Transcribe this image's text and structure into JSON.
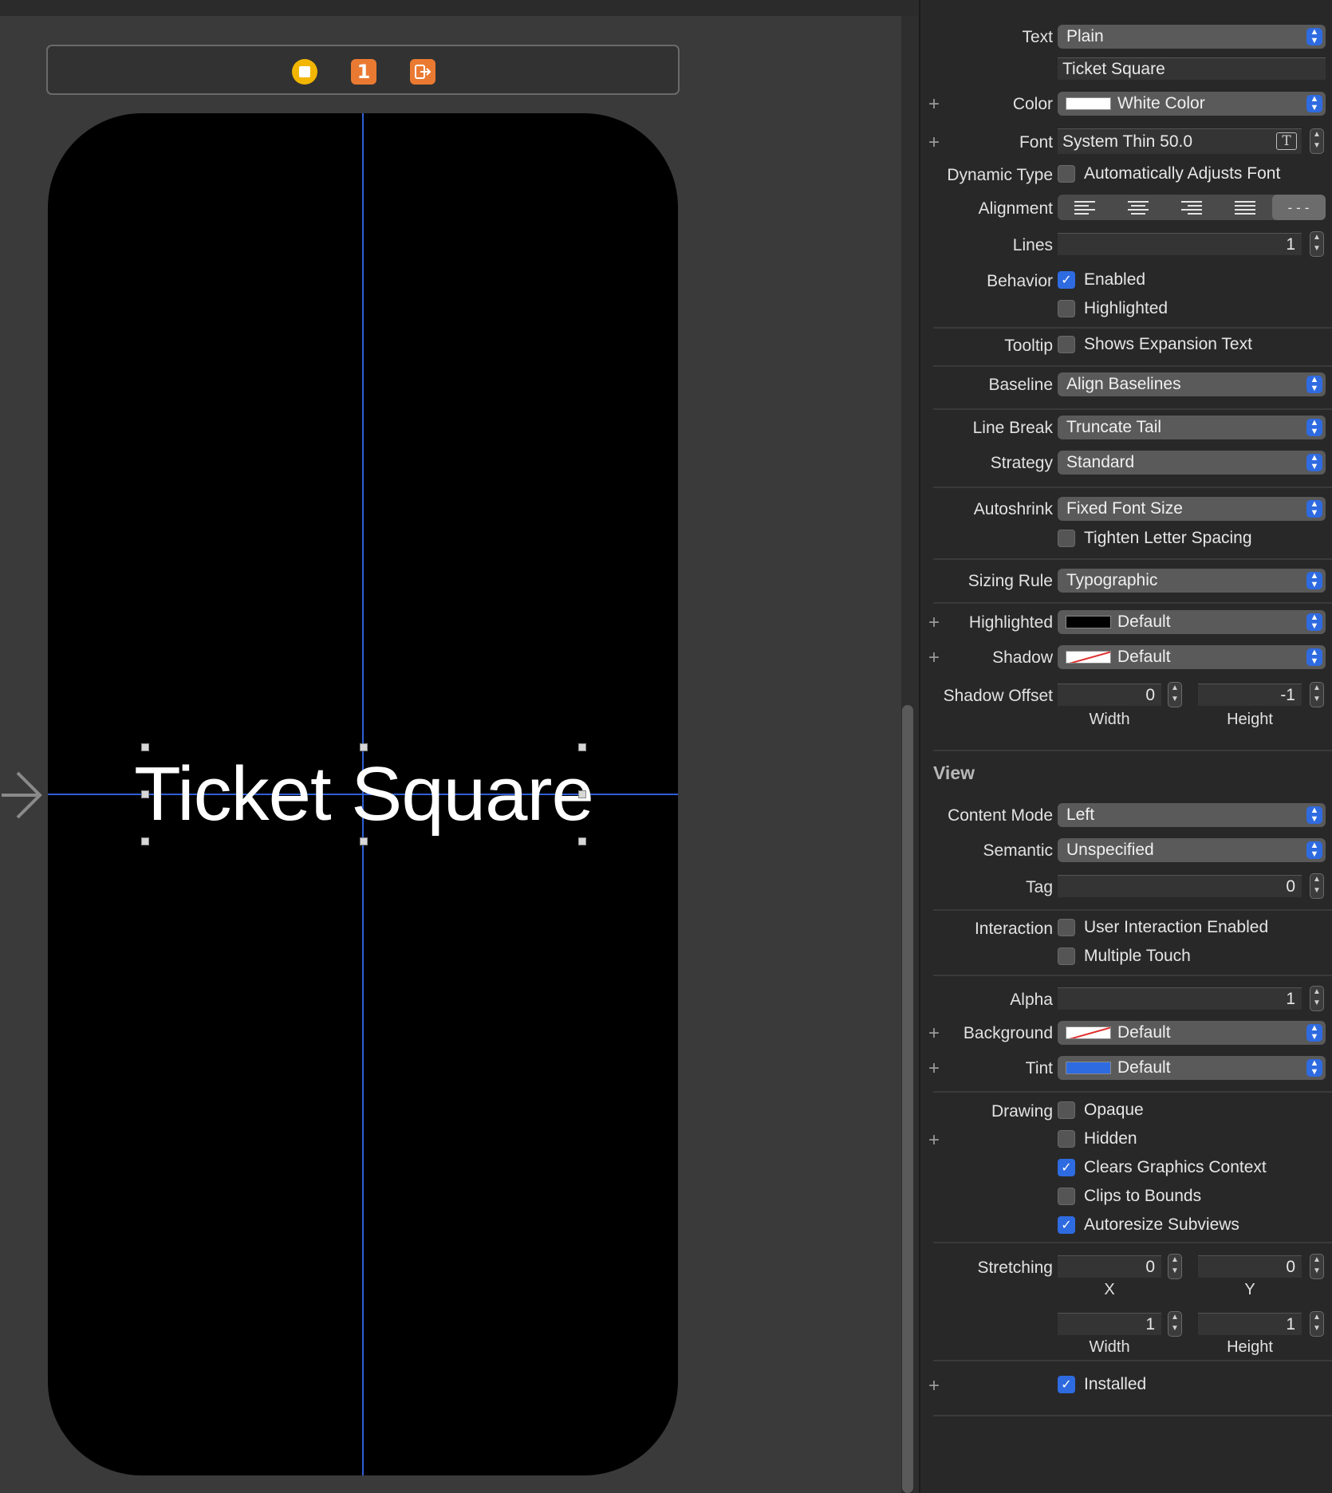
{
  "canvas": {
    "scene_dock_icons": [
      "view-controller-icon",
      "first-responder-icon",
      "exit-icon"
    ],
    "first_responder_glyph": "1",
    "label_text": "Ticket Square"
  },
  "inspector": {
    "text_row": {
      "label": "Text",
      "value": "Plain"
    },
    "text_value": "Ticket Square",
    "color_row": {
      "label": "Color",
      "value": "White Color",
      "swatch": "#ffffff"
    },
    "font_row": {
      "label": "Font",
      "value": "System Thin 50.0"
    },
    "dynamic_type": {
      "label": "Dynamic Type",
      "option": "Automatically Adjusts Font",
      "checked": false
    },
    "alignment": {
      "label": "Alignment",
      "options": [
        "left",
        "center",
        "right",
        "justified",
        "natural"
      ],
      "selected": "natural",
      "natural_glyph": "---"
    },
    "lines": {
      "label": "Lines",
      "value": "1"
    },
    "behavior": {
      "label": "Behavior",
      "enabled": "Enabled",
      "highlighted": "Highlighted"
    },
    "tooltip": {
      "label": "Tooltip",
      "option": "Shows Expansion Text"
    },
    "baseline": {
      "label": "Baseline",
      "value": "Align Baselines"
    },
    "line_break": {
      "label": "Line Break",
      "value": "Truncate Tail"
    },
    "strategy": {
      "label": "Strategy",
      "value": "Standard"
    },
    "autoshrink": {
      "label": "Autoshrink",
      "value": "Fixed Font Size",
      "option": "Tighten Letter Spacing"
    },
    "sizing_rule": {
      "label": "Sizing Rule",
      "value": "Typographic"
    },
    "highlighted_color": {
      "label": "Highlighted",
      "value": "Default",
      "swatch": "#000000"
    },
    "shadow": {
      "label": "Shadow",
      "value": "Default"
    },
    "shadow_offset": {
      "label": "Shadow Offset",
      "width": "0",
      "height": "-1",
      "width_label": "Width",
      "height_label": "Height"
    },
    "view_section": {
      "title": "View",
      "content_mode": {
        "label": "Content Mode",
        "value": "Left"
      },
      "semantic": {
        "label": "Semantic",
        "value": "Unspecified"
      },
      "tag": {
        "label": "Tag",
        "value": "0"
      },
      "interaction": {
        "label": "Interaction",
        "user_interaction": "User Interaction Enabled",
        "multiple_touch": "Multiple Touch"
      },
      "alpha": {
        "label": "Alpha",
        "value": "1"
      },
      "background": {
        "label": "Background",
        "value": "Default"
      },
      "tint": {
        "label": "Tint",
        "value": "Default",
        "swatch": "#2f6be0"
      },
      "drawing": {
        "label": "Drawing",
        "opaque": "Opaque",
        "hidden": "Hidden",
        "clears": "Clears Graphics Context",
        "clips": "Clips to Bounds",
        "autoresize": "Autoresize Subviews"
      },
      "stretching": {
        "label": "Stretching",
        "x": "0",
        "y": "0",
        "width": "1",
        "height": "1",
        "x_label": "X",
        "y_label": "Y",
        "width_label": "Width",
        "height_label": "Height"
      },
      "installed": "Installed"
    }
  }
}
